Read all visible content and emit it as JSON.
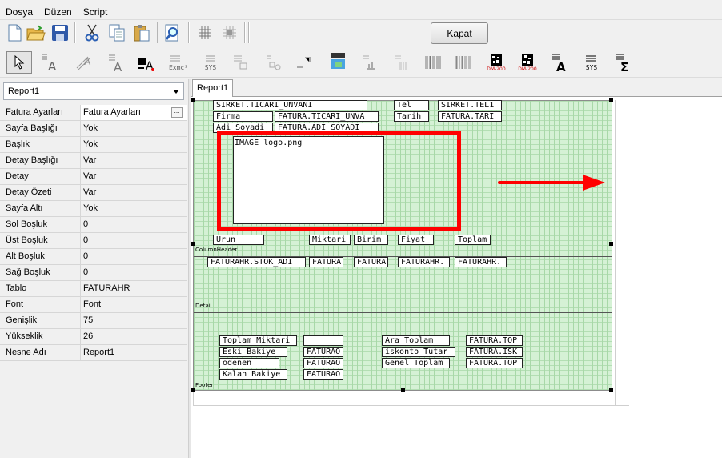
{
  "menu": {
    "items": [
      "Dosya",
      "Düzen",
      "Script"
    ]
  },
  "toolbar": {
    "close_label": "Kapat"
  },
  "left": {
    "report_select": "Report1",
    "properties": [
      {
        "name": "Fatura Ayarları",
        "value": "Fatura Ayarları"
      },
      {
        "name": "Sayfa Başlığı",
        "value": "Yok"
      },
      {
        "name": "Başlık",
        "value": "Yok"
      },
      {
        "name": "Detay Başlığı",
        "value": "Var"
      },
      {
        "name": "Detay",
        "value": "Var"
      },
      {
        "name": "Detay Özeti",
        "value": "Var"
      },
      {
        "name": "Sayfa Altı",
        "value": "Yok"
      },
      {
        "name": "Sol Boşluk",
        "value": "0"
      },
      {
        "name": "Üst Boşluk",
        "value": "0"
      },
      {
        "name": "Alt Boşluk",
        "value": "0"
      },
      {
        "name": "Sağ Boşluk",
        "value": "0"
      },
      {
        "name": "Tablo",
        "value": "FATURAHR"
      },
      {
        "name": "Font",
        "value": "Font"
      },
      {
        "name": "Genişlik",
        "value": "75"
      },
      {
        "name": "Yükseklik",
        "value": "26"
      },
      {
        "name": "Nesne Adı",
        "value": "Report1"
      }
    ]
  },
  "tab": {
    "label": "Report1"
  },
  "icons": {
    "row1": [
      "new-file-icon",
      "open-folder-icon",
      "save-icon",
      "cut-icon",
      "copy-icon",
      "paste-icon",
      "preview-icon",
      "grid-icon",
      "snap-grid-icon"
    ],
    "row2": [
      "pointer-icon",
      "label-tool-icon",
      "rotated-label-icon",
      "memo-tool-icon",
      "formula-tool-icon",
      "expression-tool-icon",
      "system-var-tool-icon",
      "richtext-tool-icon",
      "shape-tool-icon",
      "line-tool-icon",
      "image-tool-icon",
      "chart-tool-icon",
      "barcode-tool-icon",
      "barcode2-tool-icon",
      "datamatrix-tool-icon",
      "datamatrix2-tool-icon",
      "text-a-tool-icon",
      "sysdata-tool-icon",
      "sum-tool-icon"
    ]
  },
  "report": {
    "header_fields": [
      "SIRKET.TICARI_UNVANI",
      "Tel",
      "SIRKET.TEL1",
      "Firma",
      "FATURA.TICARI_UNVA",
      "Tarih",
      "FATURA.TARI",
      "Adi Soyadi",
      "FATURA.ADI_SOYADI"
    ],
    "image_label": "IMAGE_logo.png",
    "column_headers": [
      "Urun",
      "Miktari",
      "Birim",
      "Fiyat",
      "Toplam"
    ],
    "column_header_band": "ColumnHeader",
    "detail_fields": [
      "FATURAHR.STOK_ADI",
      "FATURA",
      "FATURA",
      "FATURAHR.",
      "FATURAHR."
    ],
    "detail_band": "Detail",
    "footer_fields": [
      "Toplam Miktari",
      "",
      "Ara Toplam",
      "FATURA.TOP",
      "Eski Bakiye",
      "FATURAO",
      "iskonto Tutar",
      "FATURA.ISK",
      "odenen",
      "FATURAO",
      "Genel Toplam",
      "FATURA.TOP",
      "Kalan Bakiye",
      "FATURAO"
    ],
    "footer_band": "Footer",
    "barcode_caption": "DM-200",
    "sys_caption": "SYS",
    "expr_caption": "Exmc²"
  },
  "colors": {
    "annotation": "#ff0000",
    "grid_bg": "#d5f1d5"
  }
}
